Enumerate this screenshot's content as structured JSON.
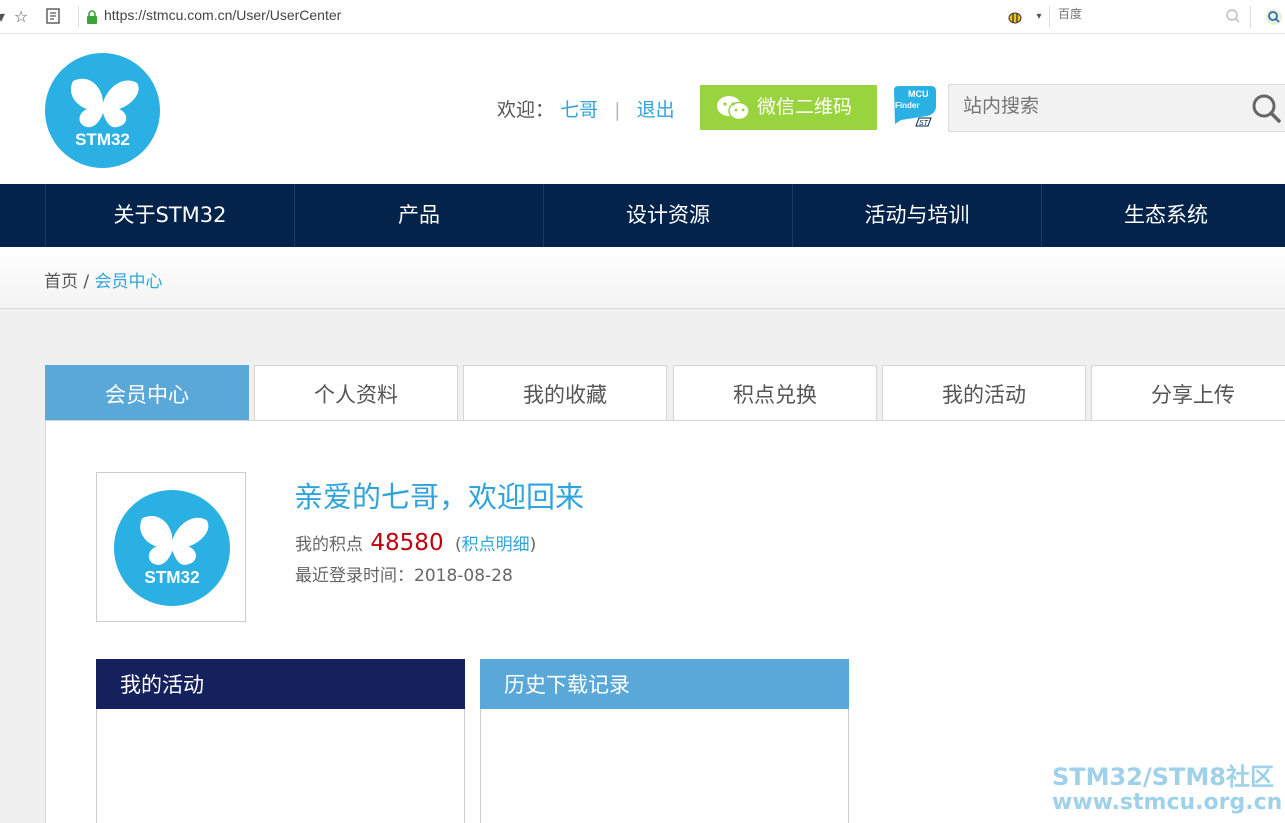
{
  "browser": {
    "url": "https://stmcu.com.cn/User/UserCenter",
    "search_placeholder": "百度"
  },
  "header": {
    "logo_text": "STM32",
    "welcome_label": "欢迎：",
    "username": "七哥",
    "logout": "退出",
    "wechat_button": "微信二维码",
    "mcu_finder_line1": "MCU",
    "mcu_finder_line2": "Finder",
    "search_placeholder": "站内搜索"
  },
  "nav": {
    "items": [
      "关于STM32",
      "产品",
      "设计资源",
      "活动与培训",
      "生态系统"
    ]
  },
  "breadcrumb": {
    "home": "首页",
    "separator": " / ",
    "current": "会员中心"
  },
  "tabs": [
    "会员中心",
    "个人资料",
    "我的收藏",
    "积点兑换",
    "我的活动",
    "分享上传"
  ],
  "profile": {
    "avatar_text": "STM32",
    "greeting": "亲爱的七哥，欢迎回来",
    "points_label": "我的积点",
    "points_value": "48580",
    "points_detail_open": "(",
    "points_detail": "积点明细",
    "points_detail_close": ")",
    "last_login": "最近登录时间：2018-08-28"
  },
  "boxes": {
    "activities": "我的活动",
    "downloads": "历史下载记录"
  },
  "watermark": {
    "line1": "STM32/STM8社区",
    "line2": "www.stmcu.org.cn"
  },
  "colors": {
    "nav_bg": "#03234b",
    "accent_blue": "#2fa4dc",
    "tab_active": "#5aa8d8",
    "wechat_green": "#99d33d",
    "points_red": "#c0000b",
    "box_dark": "#14215c"
  }
}
